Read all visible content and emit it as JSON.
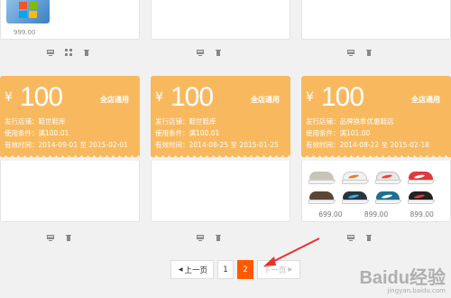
{
  "top_cards": [
    {
      "price": "999.00"
    },
    {
      "price": ""
    },
    {
      "price": ""
    }
  ],
  "coupons": [
    {
      "currency": "¥",
      "amount": "100",
      "scope": "全店通用",
      "store_line": "发行店铺：鞋世鞋库",
      "condition_line": "使用条件：满100.01",
      "validity_line": "有效时间：2014-09-01 至 2015-02-01"
    },
    {
      "currency": "¥",
      "amount": "100",
      "scope": "全店通用",
      "store_line": "发行店铺：鞋世鞋库",
      "condition_line": "使用条件：满100.01",
      "validity_line": "有效时间：2014-08-25 至 2015-01-25"
    },
    {
      "currency": "¥",
      "amount": "100",
      "scope": "全店通用",
      "store_line": "发行店铺：品牌换季优惠鞋店",
      "condition_line": "使用条件：满101.00",
      "validity_line": "有效时间：2014-08-22 至 2015-02-18"
    }
  ],
  "product_prices": [
    "699.00",
    "899.00",
    "899.00"
  ],
  "pagination": {
    "prev_label": "上一页",
    "pages": [
      "1",
      "2"
    ],
    "current_page": "2",
    "next_label": "下一页"
  },
  "watermark": {
    "main": "Baidu经验",
    "sub": "jingyan.baidu.com"
  },
  "colors": {
    "coupon_bg": "#f8b95e",
    "active_page": "#ff5a00",
    "arrow": "#e8312e"
  },
  "icons": {
    "screen": "screen-icon",
    "puzzle": "puzzle-icon",
    "trash": "trash-icon",
    "windows": "windows-logo-icon"
  }
}
